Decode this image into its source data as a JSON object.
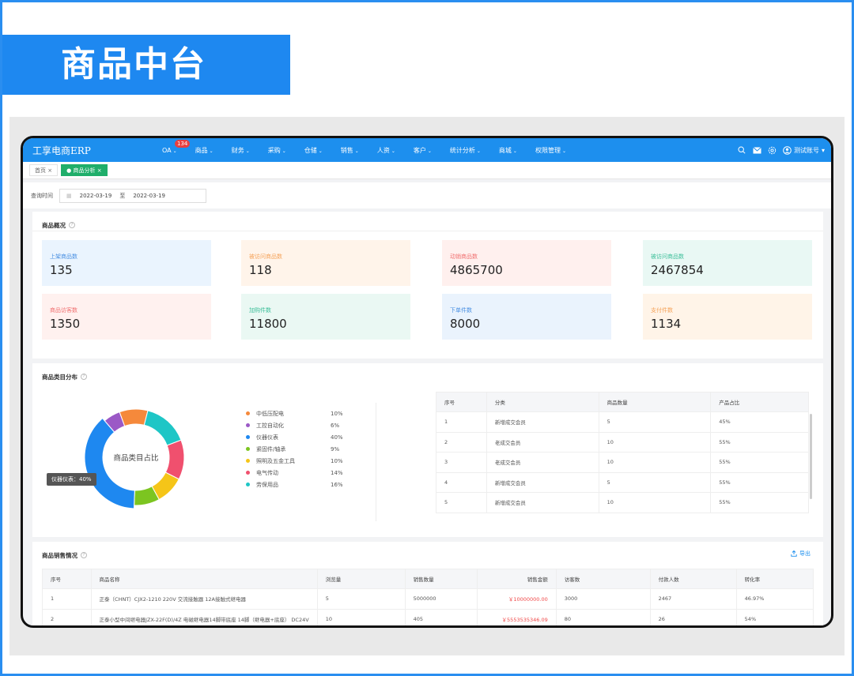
{
  "banner_title": "商品中台",
  "nav": {
    "logo": "工享电商ERP",
    "items": [
      {
        "label": "OA",
        "badge": "134"
      },
      {
        "label": "商品"
      },
      {
        "label": "财务"
      },
      {
        "label": "采购"
      },
      {
        "label": "仓储"
      },
      {
        "label": "销售"
      },
      {
        "label": "人资"
      },
      {
        "label": "客户"
      },
      {
        "label": "统计分析"
      },
      {
        "label": "商城"
      },
      {
        "label": "权限管理"
      }
    ],
    "user": "测试账号",
    "icons": [
      "search-icon",
      "mail-icon",
      "settings-icon",
      "user-icon"
    ]
  },
  "tabs": {
    "home": "首页",
    "active": "商品分析"
  },
  "query": {
    "label": "查询时间",
    "start": "2022-03-19",
    "sep": "至",
    "end": "2022-03-19"
  },
  "overview": {
    "title": "商品概况",
    "stats": [
      {
        "label": "上架商品数",
        "value": "135",
        "color": "#4a90e2",
        "bg": "#eaf4fe"
      },
      {
        "label": "被访问商品数",
        "value": "118",
        "color": "#f5a35a",
        "bg": "#fff4ea"
      },
      {
        "label": "动销商品数",
        "value": "4865700",
        "color": "#f07070",
        "bg": "#fff0ee"
      },
      {
        "label": "被访问商品数",
        "value": "2467854",
        "color": "#3dbf9a",
        "bg": "#e9f8f4"
      },
      {
        "label": "商品访客数",
        "value": "1350",
        "color": "#f07070",
        "bg": "#fff1ef"
      },
      {
        "label": "加购件数",
        "value": "11800",
        "color": "#3dbf9a",
        "bg": "#eaf8f3"
      },
      {
        "label": "下单件数",
        "value": "8000",
        "color": "#4a90e2",
        "bg": "#eaf3fd"
      },
      {
        "label": "支付件数",
        "value": "1134",
        "color": "#f5a35a",
        "bg": "#fff4e8"
      }
    ]
  },
  "category": {
    "title": "商品类目分布",
    "donut_center": "商品类目占比",
    "tooltip": "仪器仪表：40%",
    "legend": [
      {
        "name": "中低压配电",
        "pct": "10%",
        "color": "#f5893b"
      },
      {
        "name": "工控自动化",
        "pct": "6%",
        "color": "#9b59c6"
      },
      {
        "name": "仪器仪表",
        "pct": "40%",
        "color": "#1e88f0"
      },
      {
        "name": "紧固件/轴承",
        "pct": "9%",
        "color": "#7cc520"
      },
      {
        "name": "照明及五金工具",
        "pct": "10%",
        "color": "#f5c518"
      },
      {
        "name": "电气传动",
        "pct": "14%",
        "color": "#f0506e"
      },
      {
        "name": "劳保用品",
        "pct": "16%",
        "color": "#1ec6c6"
      }
    ],
    "chart_data": {
      "type": "pie",
      "categories": [
        "中低压配电",
        "工控自动化",
        "仪器仪表",
        "紧固件/轴承",
        "照明及五金工具",
        "电气传动",
        "劳保用品"
      ],
      "values": [
        10,
        6,
        40,
        9,
        10,
        14,
        16
      ],
      "title": "商品类目占比"
    },
    "table": {
      "headers": [
        "序号",
        "分类",
        "商品数量",
        "产品占比"
      ],
      "rows": [
        [
          "1",
          "新增成交会员",
          "5",
          "45%"
        ],
        [
          "2",
          "老成交会员",
          "10",
          "55%"
        ],
        [
          "3",
          "老成交会员",
          "10",
          "55%"
        ],
        [
          "4",
          "新增成交会员",
          "5",
          "55%"
        ],
        [
          "5",
          "新增成交会员",
          "10",
          "55%"
        ]
      ]
    }
  },
  "sales": {
    "title": "商品销售情况",
    "export": "导出",
    "headers": [
      "序号",
      "商品名称",
      "浏览量",
      "销售数量",
      "销售金额",
      "访客数",
      "付款人数",
      "转化率"
    ],
    "rows": [
      [
        "1",
        "正泰（CHNT）CJX2-1210 220V 交流接触器 12A接触式继电器",
        "5",
        "5000000",
        "￥10000000.00",
        "3000",
        "2467",
        "46.97%"
      ],
      [
        "2",
        "正泰小型中间继电器JZX-22F(D)/4Z 电磁继电器14脚带底座 14脚（继电器+底座） DC24V",
        "10",
        "405",
        "￥5553535346.09",
        "80",
        "26",
        "54%"
      ]
    ]
  }
}
